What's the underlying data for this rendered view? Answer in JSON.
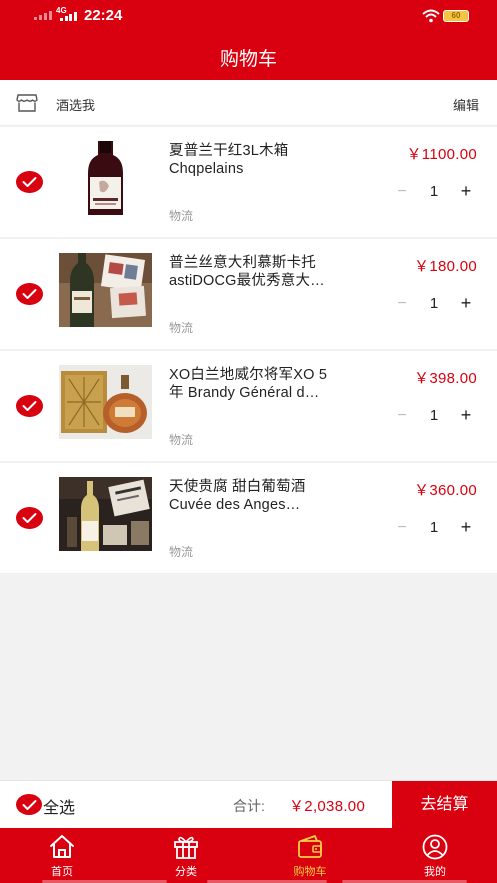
{
  "status_bar": {
    "network": "4G",
    "time": "22:24",
    "battery": "60"
  },
  "header": {
    "title": "购物车"
  },
  "shop": {
    "name": "酒选我",
    "edit_label": "编辑",
    "icon": "store-icon"
  },
  "cart_items": [
    {
      "name_line1": "夏普兰干红3L木箱",
      "name_line2": "Chqpelains",
      "tag": "物流",
      "price": "￥1100.00",
      "qty": "1",
      "selected": true
    },
    {
      "name_line1": "普兰丝意大利慕斯卡托",
      "name_line2": "astiDOCG最优秀意大…",
      "tag": "物流",
      "price": "￥180.00",
      "qty": "1",
      "selected": true
    },
    {
      "name_line1": "XO白兰地威尔将军XO 5",
      "name_line2": "年 Brandy Général d…",
      "tag": "物流",
      "price": "￥398.00",
      "qty": "1",
      "selected": true
    },
    {
      "name_line1": "天使贵腐 甜白葡萄酒",
      "name_line2": "Cuvée des Anges…",
      "tag": "物流",
      "price": "￥360.00",
      "qty": "1",
      "selected": true
    }
  ],
  "stepper": {
    "minus": "−",
    "plus": "+"
  },
  "footer": {
    "select_all_label": "全选",
    "total_label": "合计:",
    "total_amount": "￥2,038.00",
    "checkout_label": "去结算"
  },
  "tabs": [
    {
      "label": "首页",
      "icon": "home-icon",
      "active": false
    },
    {
      "label": "分类",
      "icon": "gift-icon",
      "active": false
    },
    {
      "label": "购物车",
      "icon": "wallet-icon",
      "active": true
    },
    {
      "label": "我的",
      "icon": "user-icon",
      "active": false
    }
  ],
  "colors": {
    "brand_red": "#d9000f",
    "active_tab": "#f7d046",
    "price": "#d9000f"
  }
}
